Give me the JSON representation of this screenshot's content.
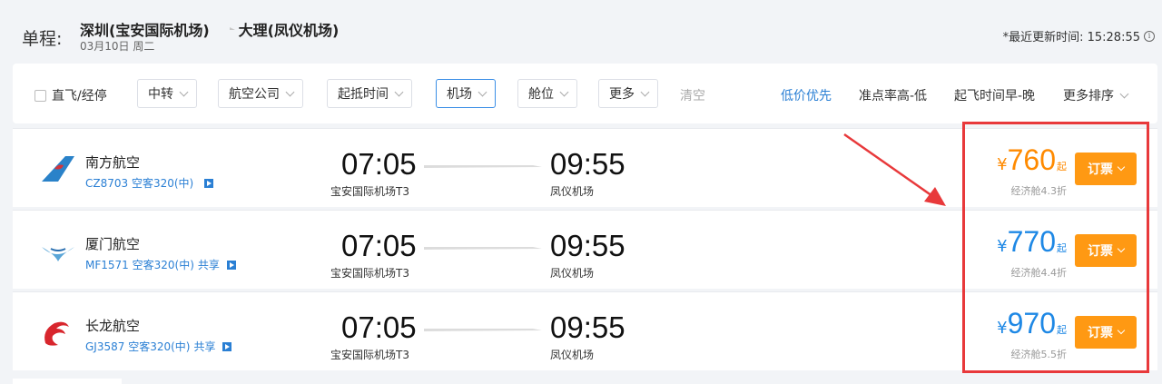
{
  "header": {
    "trip_type": "单程:",
    "origin": "深圳(宝安国际机场)",
    "destination": "大理(凤仪机场)",
    "date": "03月10日 周二",
    "updated": "*最近更新时间: 15:28:55"
  },
  "filters": {
    "direct": "直飞/经停",
    "transfer": "中转",
    "airline": "航空公司",
    "time": "起抵时间",
    "airport": "机场",
    "cabin": "舱位",
    "more": "更多",
    "clear": "清空"
  },
  "sorts": {
    "low_price": "低价优先",
    "punctuality": "准点率高-低",
    "departure": "起飞时间早-晚",
    "more": "更多排序"
  },
  "flights": [
    {
      "airline": "南方航空",
      "flight_no": "CZ8703 空客320(中)",
      "share": "",
      "dep_time": "07:05",
      "dep_airport": "宝安国际机场T3",
      "arr_time": "09:55",
      "arr_airport": "凤仪机场",
      "yen": "¥",
      "price": "760",
      "qi": "起",
      "cabin": "经济舱4.3折",
      "book": "订票",
      "price_color": "#ff8a00"
    },
    {
      "airline": "厦门航空",
      "flight_no": "MF1571 空客320(中)",
      "share": "共享",
      "dep_time": "07:05",
      "dep_airport": "宝安国际机场T3",
      "arr_time": "09:55",
      "arr_airport": "凤仪机场",
      "yen": "¥",
      "price": "770",
      "qi": "起",
      "cabin": "经济舱4.4折",
      "book": "订票",
      "price_color": "#1e88e5"
    },
    {
      "airline": "长龙航空",
      "flight_no": "GJ3587 空客320(中)",
      "share": "共享",
      "dep_time": "07:05",
      "dep_airport": "宝安国际机场T3",
      "arr_time": "09:55",
      "arr_airport": "凤仪机场",
      "yen": "¥",
      "price": "970",
      "qi": "起",
      "cabin": "经济舱5.5折",
      "book": "订票",
      "price_color": "#1e88e5"
    }
  ],
  "colors": {
    "accent": "#2a7fd4",
    "book_button": "#ff9913",
    "annotation": "#e8393b"
  }
}
